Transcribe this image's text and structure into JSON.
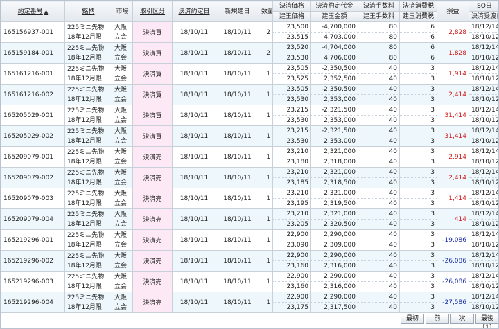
{
  "headers": {
    "order_no": "約定番号",
    "sort_arrow": "▲",
    "brand": "銘柄",
    "market": "市場",
    "kubun": "取引区分",
    "settle_date": "決済約定日",
    "new_date": "新規建日",
    "qty": "数量",
    "price_top": "決済価格",
    "price_bottom": "建玉価格",
    "amount_top": "決済約定代金",
    "amount_bottom": "建玉金額",
    "fee_top": "決済手数料",
    "fee_bottom": "建玉手数料",
    "tax_top": "決済消費税",
    "tax_bottom": "建玉消費税",
    "pl": "損益",
    "sq_top": "SQ日",
    "sq_bottom": "決済受渡日"
  },
  "rows": [
    {
      "order_no": "165156937-001",
      "brand1": "225ミニ先物",
      "brand2": "18年12月限",
      "market1": "大阪",
      "market2": "立会",
      "kubun": "決済買",
      "settle_date": "18/10/11",
      "new_date": "18/10/11",
      "qty": "2",
      "price_top": "23,500",
      "price_bottom": "23,515",
      "amount_top": "-4,700,000",
      "amount_bottom": "4,703,000",
      "fee_top": "80",
      "fee_bottom": "80",
      "tax_top": "6",
      "tax_bottom": "6",
      "pl": "2,828",
      "sq_top": "18/12/14",
      "sq_bottom": "18/10/12",
      "pl_sign": "pos"
    },
    {
      "order_no": "165159184-001",
      "brand1": "225ミニ先物",
      "brand2": "18年12月限",
      "market1": "大阪",
      "market2": "立会",
      "kubun": "決済買",
      "settle_date": "18/10/11",
      "new_date": "18/10/11",
      "qty": "2",
      "price_top": "23,520",
      "price_bottom": "23,530",
      "amount_top": "-4,704,000",
      "amount_bottom": "4,706,000",
      "fee_top": "80",
      "fee_bottom": "80",
      "tax_top": "6",
      "tax_bottom": "6",
      "pl": "1,828",
      "sq_top": "18/12/14",
      "sq_bottom": "18/10/12",
      "pl_sign": "pos"
    },
    {
      "order_no": "165161216-001",
      "brand1": "225ミニ先物",
      "brand2": "18年12月限",
      "market1": "大阪",
      "market2": "立会",
      "kubun": "決済買",
      "settle_date": "18/10/11",
      "new_date": "18/10/11",
      "qty": "1",
      "price_top": "23,505",
      "price_bottom": "23,525",
      "amount_top": "-2,350,500",
      "amount_bottom": "2,352,500",
      "fee_top": "40",
      "fee_bottom": "40",
      "tax_top": "3",
      "tax_bottom": "3",
      "pl": "1,914",
      "sq_top": "18/12/14",
      "sq_bottom": "18/10/12",
      "pl_sign": "pos"
    },
    {
      "order_no": "165161216-002",
      "brand1": "225ミニ先物",
      "brand2": "18年12月限",
      "market1": "大阪",
      "market2": "立会",
      "kubun": "決済買",
      "settle_date": "18/10/11",
      "new_date": "18/10/11",
      "qty": "1",
      "price_top": "23,505",
      "price_bottom": "23,530",
      "amount_top": "-2,350,500",
      "amount_bottom": "2,353,000",
      "fee_top": "40",
      "fee_bottom": "40",
      "tax_top": "3",
      "tax_bottom": "3",
      "pl": "2,414",
      "sq_top": "18/12/14",
      "sq_bottom": "18/10/12",
      "pl_sign": "pos"
    },
    {
      "order_no": "165205029-001",
      "brand1": "225ミニ先物",
      "brand2": "18年12月限",
      "market1": "大阪",
      "market2": "立会",
      "kubun": "決済買",
      "settle_date": "18/10/11",
      "new_date": "18/10/11",
      "qty": "1",
      "price_top": "23,215",
      "price_bottom": "23,530",
      "amount_top": "-2,321,500",
      "amount_bottom": "2,353,000",
      "fee_top": "40",
      "fee_bottom": "40",
      "tax_top": "3",
      "tax_bottom": "3",
      "pl": "31,414",
      "sq_top": "18/12/14",
      "sq_bottom": "18/10/12",
      "pl_sign": "pos"
    },
    {
      "order_no": "165205029-002",
      "brand1": "225ミニ先物",
      "brand2": "18年12月限",
      "market1": "大阪",
      "market2": "立会",
      "kubun": "決済買",
      "settle_date": "18/10/11",
      "new_date": "18/10/11",
      "qty": "1",
      "price_top": "23,215",
      "price_bottom": "23,530",
      "amount_top": "-2,321,500",
      "amount_bottom": "2,353,000",
      "fee_top": "40",
      "fee_bottom": "40",
      "tax_top": "3",
      "tax_bottom": "3",
      "pl": "31,414",
      "sq_top": "18/12/14",
      "sq_bottom": "18/10/12",
      "pl_sign": "pos"
    },
    {
      "order_no": "165209079-001",
      "brand1": "225ミニ先物",
      "brand2": "18年12月限",
      "market1": "大阪",
      "market2": "立会",
      "kubun": "決済売",
      "settle_date": "18/10/11",
      "new_date": "18/10/11",
      "qty": "1",
      "price_top": "23,210",
      "price_bottom": "23,180",
      "amount_top": "2,321,000",
      "amount_bottom": "2,318,000",
      "fee_top": "40",
      "fee_bottom": "40",
      "tax_top": "3",
      "tax_bottom": "3",
      "pl": "2,914",
      "sq_top": "18/12/14",
      "sq_bottom": "18/10/12",
      "pl_sign": "pos"
    },
    {
      "order_no": "165209079-002",
      "brand1": "225ミニ先物",
      "brand2": "18年12月限",
      "market1": "大阪",
      "market2": "立会",
      "kubun": "決済売",
      "settle_date": "18/10/11",
      "new_date": "18/10/11",
      "qty": "1",
      "price_top": "23,210",
      "price_bottom": "23,185",
      "amount_top": "2,321,000",
      "amount_bottom": "2,318,500",
      "fee_top": "40",
      "fee_bottom": "40",
      "tax_top": "3",
      "tax_bottom": "3",
      "pl": "2,414",
      "sq_top": "18/12/14",
      "sq_bottom": "18/10/12",
      "pl_sign": "pos"
    },
    {
      "order_no": "165209079-003",
      "brand1": "225ミニ先物",
      "brand2": "18年12月限",
      "market1": "大阪",
      "market2": "立会",
      "kubun": "決済売",
      "settle_date": "18/10/11",
      "new_date": "18/10/11",
      "qty": "1",
      "price_top": "23,210",
      "price_bottom": "23,195",
      "amount_top": "2,321,000",
      "amount_bottom": "2,319,500",
      "fee_top": "40",
      "fee_bottom": "40",
      "tax_top": "3",
      "tax_bottom": "3",
      "pl": "1,414",
      "sq_top": "18/12/14",
      "sq_bottom": "18/10/12",
      "pl_sign": "pos"
    },
    {
      "order_no": "165209079-004",
      "brand1": "225ミニ先物",
      "brand2": "18年12月限",
      "market1": "大阪",
      "market2": "立会",
      "kubun": "決済売",
      "settle_date": "18/10/11",
      "new_date": "18/10/11",
      "qty": "1",
      "price_top": "23,210",
      "price_bottom": "23,205",
      "amount_top": "2,321,000",
      "amount_bottom": "2,320,500",
      "fee_top": "40",
      "fee_bottom": "40",
      "tax_top": "3",
      "tax_bottom": "3",
      "pl": "414",
      "sq_top": "18/12/14",
      "sq_bottom": "18/10/12",
      "pl_sign": "pos"
    },
    {
      "order_no": "165219296-001",
      "brand1": "225ミニ先物",
      "brand2": "18年12月限",
      "market1": "大阪",
      "market2": "立会",
      "kubun": "決済売",
      "settle_date": "18/10/11",
      "new_date": "18/10/11",
      "qty": "1",
      "price_top": "22,900",
      "price_bottom": "23,090",
      "amount_top": "2,290,000",
      "amount_bottom": "2,309,000",
      "fee_top": "40",
      "fee_bottom": "40",
      "tax_top": "3",
      "tax_bottom": "3",
      "pl": "-19,086",
      "sq_top": "18/12/14",
      "sq_bottom": "18/10/12",
      "pl_sign": "neg"
    },
    {
      "order_no": "165219296-002",
      "brand1": "225ミニ先物",
      "brand2": "18年12月限",
      "market1": "大阪",
      "market2": "立会",
      "kubun": "決済売",
      "settle_date": "18/10/11",
      "new_date": "18/10/11",
      "qty": "1",
      "price_top": "22,900",
      "price_bottom": "23,160",
      "amount_top": "2,290,000",
      "amount_bottom": "2,316,000",
      "fee_top": "40",
      "fee_bottom": "40",
      "tax_top": "3",
      "tax_bottom": "3",
      "pl": "-26,086",
      "sq_top": "18/12/14",
      "sq_bottom": "18/10/12",
      "pl_sign": "neg"
    },
    {
      "order_no": "165219296-003",
      "brand1": "225ミニ先物",
      "brand2": "18年12月限",
      "market1": "大阪",
      "market2": "立会",
      "kubun": "決済売",
      "settle_date": "18/10/11",
      "new_date": "18/10/11",
      "qty": "1",
      "price_top": "22,900",
      "price_bottom": "23,160",
      "amount_top": "2,290,000",
      "amount_bottom": "2,316,000",
      "fee_top": "40",
      "fee_bottom": "40",
      "tax_top": "3",
      "tax_bottom": "3",
      "pl": "-26,086",
      "sq_top": "18/12/14",
      "sq_bottom": "18/10/12",
      "pl_sign": "neg"
    },
    {
      "order_no": "165219296-004",
      "brand1": "225ミニ先物",
      "brand2": "18年12月限",
      "market1": "大阪",
      "market2": "立会",
      "kubun": "決済売",
      "settle_date": "18/10/11",
      "new_date": "18/10/11",
      "qty": "1",
      "price_top": "22,900",
      "price_bottom": "23,175",
      "amount_top": "2,290,000",
      "amount_bottom": "2,317,500",
      "fee_top": "40",
      "fee_bottom": "40",
      "tax_top": "3",
      "tax_bottom": "3",
      "pl": "-27,586",
      "sq_top": "18/12/14",
      "sq_bottom": "18/10/12",
      "pl_sign": "neg"
    }
  ],
  "pager": {
    "first": "最初",
    "prev": "前",
    "next": "次",
    "last": "最後[1]"
  },
  "colors": {
    "profit": "#d01818",
    "loss": "#1c2fa8",
    "kubun_bg": "#fde9f6",
    "alt_row_bg": "#eef7fb",
    "header_bg": "#e3e8ee"
  }
}
